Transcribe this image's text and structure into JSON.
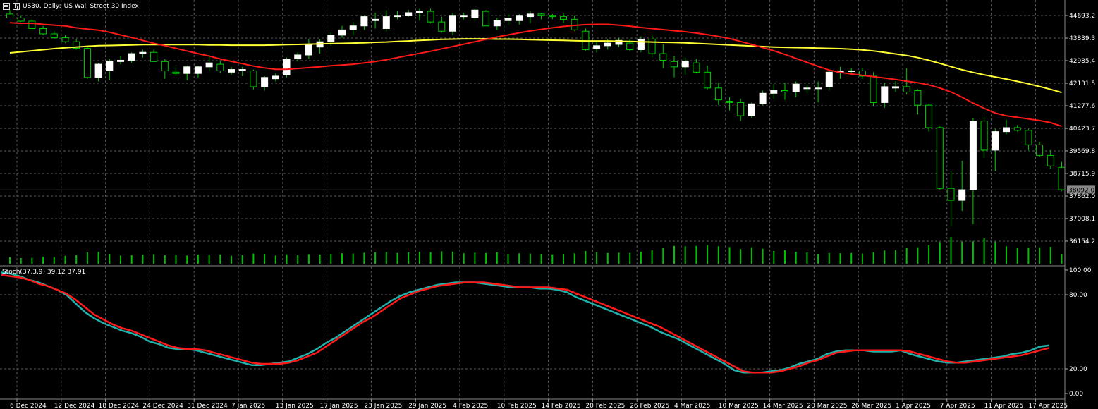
{
  "header": {
    "symbol": "US30, Daily:",
    "description": "US Wall Street 30 Index"
  },
  "stoch_header": "Stoch(37,3,9) 39.12 37.91",
  "current_price": "38092.0",
  "colors": {
    "background": "#000000",
    "grid": "#5a5a5a",
    "bull": "#ffffff",
    "wick": "#00d000",
    "ma_fast": "#ff1a1a",
    "ma_slow": "#ffff33",
    "volume": "#00c000",
    "stoch_main": "#20b2aa",
    "stoch_signal": "#ff1a1a"
  },
  "chart_data": [
    {
      "type": "candlestick",
      "title": "US30, Daily: US Wall Street 30 Index",
      "ylim": [
        35700,
        45150
      ],
      "y_ticks": [
        "44693.2",
        "43839.3",
        "42985.4",
        "42131.5",
        "41277.6",
        "40423.7",
        "39569.8",
        "38715.9",
        "37862.0",
        "37008.1",
        "36154.2"
      ],
      "y_tick_values": [
        44693.2,
        43839.3,
        42985.4,
        42131.5,
        41277.6,
        40423.7,
        39569.8,
        38715.9,
        37862.0,
        37008.1,
        36154.2
      ],
      "x_labels": [
        {
          "label": "6 Dec 2024",
          "index": 0
        },
        {
          "label": "12 Dec 2024",
          "index": 4
        },
        {
          "label": "18 Dec 2024",
          "index": 8
        },
        {
          "label": "24 Dec 2024",
          "index": 12
        },
        {
          "label": "31 Dec 2024",
          "index": 16
        },
        {
          "label": "7 Jan 2025",
          "index": 20
        },
        {
          "label": "13 Jan 2025",
          "index": 24
        },
        {
          "label": "17 Jan 2025",
          "index": 28
        },
        {
          "label": "23 Jan 2025",
          "index": 32
        },
        {
          "label": "29 Jan 2025",
          "index": 36
        },
        {
          "label": "4 Feb 2025",
          "index": 40
        },
        {
          "label": "10 Feb 2025",
          "index": 44
        },
        {
          "label": "14 Feb 2025",
          "index": 48
        },
        {
          "label": "20 Feb 2025",
          "index": 52
        },
        {
          "label": "26 Feb 2025",
          "index": 56
        },
        {
          "label": "4 Mar 2025",
          "index": 60
        },
        {
          "label": "10 Mar 2025",
          "index": 64
        },
        {
          "label": "14 Mar 2025",
          "index": 68
        },
        {
          "label": "20 Mar 2025",
          "index": 72
        },
        {
          "label": "26 Mar 2025",
          "index": 76
        },
        {
          "label": "1 Apr 2025",
          "index": 80
        },
        {
          "label": "7 Apr 2025",
          "index": 84
        },
        {
          "label": "11 Apr 2025",
          "index": 88
        },
        {
          "label": "17 Apr 2025",
          "index": 92
        }
      ],
      "candles": [
        [
          44750,
          44900,
          44600,
          44600
        ],
        [
          44600,
          44700,
          44450,
          44480
        ],
        [
          44480,
          44550,
          44200,
          44200
        ],
        [
          44200,
          44300,
          43950,
          44000
        ],
        [
          44000,
          44100,
          43800,
          43850
        ],
        [
          43850,
          43950,
          43650,
          43700
        ],
        [
          43700,
          43800,
          43400,
          43450
        ],
        [
          43450,
          43550,
          42300,
          42350
        ],
        [
          42350,
          42900,
          42200,
          42850
        ],
        [
          42600,
          43050,
          42250,
          42950
        ],
        [
          42950,
          43150,
          42850,
          43000
        ],
        [
          43000,
          43300,
          42900,
          43250
        ],
        [
          43250,
          43400,
          43100,
          43300
        ],
        [
          43300,
          43400,
          42950,
          42950
        ],
        [
          42950,
          43050,
          42300,
          42600
        ],
        [
          42550,
          42750,
          42400,
          42500
        ],
        [
          42500,
          42800,
          42250,
          42750
        ],
        [
          42500,
          42800,
          42350,
          42750
        ],
        [
          42750,
          43200,
          42600,
          42900
        ],
        [
          42850,
          43000,
          42500,
          42600
        ],
        [
          42550,
          42750,
          42450,
          42650
        ],
        [
          42600,
          42750,
          42400,
          42650
        ],
        [
          42600,
          42650,
          41900,
          42000
        ],
        [
          42000,
          42400,
          41850,
          42350
        ],
        [
          42300,
          42500,
          42200,
          42400
        ],
        [
          42450,
          43100,
          42350,
          43050
        ],
        [
          43050,
          43300,
          42950,
          43200
        ],
        [
          43200,
          43800,
          43050,
          43600
        ],
        [
          43500,
          43800,
          43250,
          43700
        ],
        [
          43700,
          44050,
          43550,
          43950
        ],
        [
          43950,
          44300,
          43850,
          44150
        ],
        [
          44150,
          44450,
          43950,
          44300
        ],
        [
          44300,
          44700,
          44150,
          44650
        ],
        [
          44500,
          44800,
          44200,
          44550
        ],
        [
          44200,
          44900,
          44100,
          44650
        ],
        [
          44650,
          44850,
          44550,
          44700
        ],
        [
          44700,
          44900,
          44650,
          44800
        ],
        [
          44800,
          44950,
          44500,
          44850
        ],
        [
          44850,
          44950,
          44400,
          44450
        ],
        [
          44450,
          44650,
          44050,
          44100
        ],
        [
          44100,
          44800,
          43950,
          44700
        ],
        [
          44650,
          44800,
          44550,
          44700
        ],
        [
          44600,
          44950,
          44500,
          44900
        ],
        [
          44850,
          44900,
          44300,
          44300
        ],
        [
          44300,
          44600,
          44150,
          44500
        ],
        [
          44500,
          44750,
          44350,
          44600
        ],
        [
          44500,
          44750,
          44350,
          44700
        ],
        [
          44650,
          44850,
          44400,
          44750
        ],
        [
          44750,
          44800,
          44550,
          44700
        ],
        [
          44700,
          44750,
          44550,
          44650
        ],
        [
          44650,
          44800,
          44400,
          44550
        ],
        [
          44550,
          44700,
          44100,
          44150
        ],
        [
          44100,
          44200,
          43350,
          43400
        ],
        [
          43450,
          43750,
          43300,
          43550
        ],
        [
          43550,
          43800,
          43400,
          43650
        ],
        [
          43600,
          43850,
          43500,
          43750
        ],
        [
          43650,
          43800,
          43350,
          43400
        ],
        [
          43400,
          43900,
          43300,
          43800
        ],
        [
          43800,
          43950,
          43100,
          43250
        ],
        [
          43250,
          43600,
          42700,
          43000
        ],
        [
          42950,
          43150,
          42350,
          42750
        ],
        [
          42750,
          43100,
          42450,
          42950
        ],
        [
          42900,
          43050,
          42500,
          42550
        ],
        [
          42550,
          42800,
          41900,
          41950
        ],
        [
          41950,
          42150,
          41300,
          41500
        ],
        [
          41450,
          41600,
          41100,
          41400
        ],
        [
          41400,
          41550,
          40700,
          40900
        ],
        [
          40900,
          41400,
          40800,
          41350
        ],
        [
          41350,
          41850,
          41300,
          41750
        ],
        [
          41750,
          42100,
          41550,
          41850
        ],
        [
          41850,
          42150,
          41500,
          41800
        ],
        [
          41800,
          42200,
          41600,
          42100
        ],
        [
          41950,
          42100,
          41750,
          41950
        ],
        [
          41950,
          42200,
          41400,
          41950
        ],
        [
          42000,
          42650,
          41850,
          42550
        ],
        [
          42550,
          42750,
          42300,
          42600
        ],
        [
          42600,
          42700,
          42450,
          42600
        ],
        [
          42600,
          42700,
          42300,
          42400
        ],
        [
          42400,
          42550,
          41250,
          41400
        ],
        [
          41400,
          42150,
          41200,
          42000
        ],
        [
          41950,
          42200,
          41800,
          42000
        ],
        [
          42000,
          42700,
          41700,
          41800
        ],
        [
          41850,
          41900,
          40950,
          41300
        ],
        [
          41300,
          41350,
          40300,
          40450
        ],
        [
          40450,
          40500,
          38100,
          38150
        ],
        [
          38150,
          38800,
          36700,
          37700
        ],
        [
          37700,
          39200,
          37300,
          38100
        ],
        [
          38100,
          40800,
          36800,
          40700
        ],
        [
          40700,
          40850,
          39300,
          39600
        ],
        [
          39600,
          40400,
          38800,
          40300
        ],
        [
          40300,
          40750,
          40200,
          40450
        ],
        [
          40450,
          40550,
          40300,
          40350
        ],
        [
          40350,
          40400,
          39600,
          39800
        ],
        [
          39800,
          39900,
          39350,
          39400
        ],
        [
          39400,
          39600,
          38900,
          39000
        ],
        [
          38950,
          39150,
          38050,
          38100
        ]
      ],
      "ma_fast": [
        44420,
        44400,
        44400,
        44360,
        44330,
        44300,
        44230,
        44180,
        44140,
        44060,
        43960,
        43860,
        43750,
        43640,
        43550,
        43450,
        43350,
        43250,
        43160,
        43050,
        42960,
        42870,
        42780,
        42710,
        42660,
        42660,
        42690,
        42720,
        42750,
        42790,
        42820,
        42850,
        42900,
        42950,
        43020,
        43100,
        43180,
        43260,
        43340,
        43430,
        43520,
        43610,
        43700,
        43790,
        43880,
        43960,
        44040,
        44110,
        44170,
        44230,
        44280,
        44320,
        44350,
        44360,
        44360,
        44330,
        44290,
        44240,
        44200,
        44160,
        44120,
        44080,
        44030,
        43970,
        43900,
        43820,
        43710,
        43600,
        43480,
        43360,
        43220,
        43070,
        42920,
        42770,
        42630,
        42540,
        42480,
        42430,
        42380,
        42330,
        42270,
        42210,
        42150,
        42070,
        41950,
        41800,
        41600,
        41380,
        41180,
        41000,
        40900,
        40840,
        40780,
        40720,
        40640,
        40500
      ],
      "ma_slow": [
        43280,
        43320,
        43360,
        43400,
        43440,
        43470,
        43500,
        43530,
        43550,
        43560,
        43570,
        43580,
        43590,
        43590,
        43590,
        43590,
        43590,
        43590,
        43580,
        43580,
        43570,
        43570,
        43570,
        43570,
        43580,
        43590,
        43600,
        43610,
        43620,
        43630,
        43640,
        43650,
        43660,
        43680,
        43690,
        43710,
        43730,
        43750,
        43770,
        43790,
        43800,
        43810,
        43810,
        43810,
        43800,
        43800,
        43790,
        43780,
        43770,
        43760,
        43750,
        43740,
        43730,
        43730,
        43730,
        43720,
        43710,
        43700,
        43690,
        43680,
        43670,
        43660,
        43640,
        43620,
        43600,
        43580,
        43560,
        43540,
        43520,
        43500,
        43490,
        43480,
        43470,
        43460,
        43450,
        43440,
        43420,
        43390,
        43350,
        43300,
        43240,
        43180,
        43100,
        43000,
        42880,
        42760,
        42640,
        42540,
        42450,
        42370,
        42290,
        42200,
        42110,
        42010,
        41900,
        41780
      ],
      "volume": [
        0.23,
        0.2,
        0.21,
        0.24,
        0.23,
        0.28,
        0.3,
        0.4,
        0.42,
        0.35,
        0.29,
        0.3,
        0.32,
        0.34,
        0.3,
        0.31,
        0.29,
        0.32,
        0.31,
        0.33,
        0.28,
        0.3,
        0.36,
        0.35,
        0.29,
        0.33,
        0.3,
        0.34,
        0.33,
        0.35,
        0.37,
        0.36,
        0.39,
        0.4,
        0.41,
        0.38,
        0.4,
        0.42,
        0.41,
        0.44,
        0.43,
        0.37,
        0.39,
        0.38,
        0.4,
        0.35,
        0.37,
        0.36,
        0.35,
        0.33,
        0.35,
        0.37,
        0.45,
        0.4,
        0.38,
        0.39,
        0.38,
        0.42,
        0.48,
        0.55,
        0.63,
        0.62,
        0.63,
        0.66,
        0.62,
        0.59,
        0.52,
        0.58,
        0.53,
        0.45,
        0.48,
        0.42,
        0.4,
        0.35,
        0.38,
        0.37,
        0.38,
        0.36,
        0.4,
        0.47,
        0.48,
        0.55,
        0.58,
        0.65,
        0.77,
        0.95,
        0.78,
        0.79,
        0.9,
        0.78,
        0.62,
        0.55,
        0.57,
        0.58,
        0.6,
        0.35
      ]
    },
    {
      "type": "line",
      "title": "Stoch(37,3,9) 39.12 37.91",
      "ylim": [
        0,
        100
      ],
      "y_ticks": [
        "100.00",
        "80.00",
        "20.00",
        "0.00"
      ],
      "y_tick_values": [
        100,
        80,
        20,
        0
      ],
      "series": [
        {
          "name": "main",
          "color": "#20b2aa",
          "values": [
            98,
            97,
            95,
            92,
            90,
            87,
            84,
            80,
            73,
            66,
            61,
            57,
            54,
            51,
            49,
            46,
            42,
            40,
            37,
            36,
            36,
            35,
            33,
            31,
            29,
            27,
            25,
            23,
            23,
            24,
            25,
            26,
            29,
            32,
            36,
            41,
            45,
            50,
            55,
            60,
            65,
            70,
            75,
            79,
            82,
            84,
            86,
            88,
            89,
            90,
            90,
            90,
            89,
            88,
            87,
            86,
            86,
            86,
            85,
            85,
            84,
            82,
            78,
            75,
            72,
            69,
            66,
            63,
            60,
            57,
            54,
            50,
            47,
            44,
            40,
            36,
            32,
            28,
            24,
            19,
            17,
            17,
            17,
            18,
            19,
            21,
            24,
            26,
            28,
            32,
            34,
            35,
            35,
            35,
            34,
            34,
            34,
            35,
            32,
            30,
            28,
            26,
            25,
            25,
            26,
            27,
            28,
            29,
            30,
            32,
            33,
            35,
            38,
            39
          ]
        },
        {
          "name": "signal",
          "color": "#ff1a1a",
          "values": [
            96,
            95,
            94,
            92,
            89,
            87,
            84,
            81,
            76,
            70,
            64,
            60,
            56,
            53,
            51,
            48,
            45,
            42,
            39,
            37,
            36,
            36,
            35,
            33,
            31,
            29,
            27,
            25,
            24,
            24,
            24,
            25,
            27,
            30,
            33,
            38,
            43,
            48,
            53,
            58,
            62,
            67,
            72,
            77,
            80,
            83,
            85,
            87,
            88,
            89,
            90,
            90,
            90,
            89,
            88,
            87,
            86,
            86,
            86,
            86,
            85,
            84,
            81,
            78,
            75,
            72,
            69,
            66,
            63,
            60,
            57,
            54,
            50,
            46,
            42,
            38,
            34,
            30,
            26,
            22,
            18,
            17,
            17,
            17,
            18,
            20,
            22,
            25,
            27,
            30,
            33,
            34,
            35,
            35,
            35,
            35,
            35,
            35,
            34,
            32,
            30,
            28,
            26,
            25,
            25,
            26,
            27,
            28,
            29,
            30,
            31,
            33,
            35,
            37
          ]
        }
      ]
    }
  ]
}
